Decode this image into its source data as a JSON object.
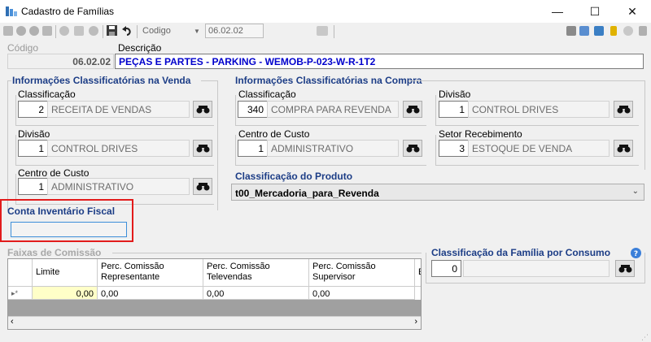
{
  "window": {
    "title": "Cadastro de Famílias",
    "controls": [
      "—",
      "☐",
      "✕"
    ]
  },
  "toolbar": {
    "codigo_label": "Codigo",
    "codigo_value": "06.02.02"
  },
  "header": {
    "codigo_label": "Código",
    "descricao_label": "Descrição",
    "codigo_value": "06.02.02",
    "descricao_value": "PEÇAS E PARTES - PARKING - WEMOB-P-023-W-R-1T2"
  },
  "venda": {
    "title": "Informações Classificatórias na Venda",
    "classificacao": {
      "label": "Classificação",
      "code": "2",
      "desc": "RECEITA DE VENDAS"
    },
    "divisao": {
      "label": "Divisão",
      "code": "1",
      "desc": "CONTROL DRIVES"
    },
    "centro_custo": {
      "label": "Centro de Custo",
      "code": "1",
      "desc": "ADMINISTRATIVO"
    }
  },
  "compra": {
    "title": "Informações Classificatórias na Compra",
    "classificacao": {
      "label": "Classificação",
      "code": "340",
      "desc": "COMPRA PARA REVENDA"
    },
    "divisao": {
      "label": "Divisão",
      "code": "1",
      "desc": "CONTROL DRIVES"
    },
    "centro_custo": {
      "label": "Centro de Custo",
      "code": "1",
      "desc": "ADMINISTRATIVO"
    },
    "setor": {
      "label": "Setor Recebimento",
      "code": "3",
      "desc": "ESTOQUE DE VENDA"
    }
  },
  "produto": {
    "title": "Classificação do Produto",
    "value": "t00_Mercadoria_para_Revenda"
  },
  "conta": {
    "title": "Conta Inventário Fiscal",
    "value": ""
  },
  "faixas": {
    "title": "Faixas de Comissão",
    "headers": [
      "Limite",
      "Perc. Comissão Representante",
      "Perc. Comissão Televendas",
      "Perc. Comissão Supervisor",
      "E"
    ],
    "row": [
      "0,00",
      "0,00",
      "0,00",
      "0,00"
    ]
  },
  "consumo": {
    "title": "Classificação da Família por Consumo",
    "code": "0",
    "desc": ""
  },
  "colors": {
    "accent": "#1c3d86",
    "highlight": "#e21b1b",
    "link_blue": "#0000cc"
  }
}
